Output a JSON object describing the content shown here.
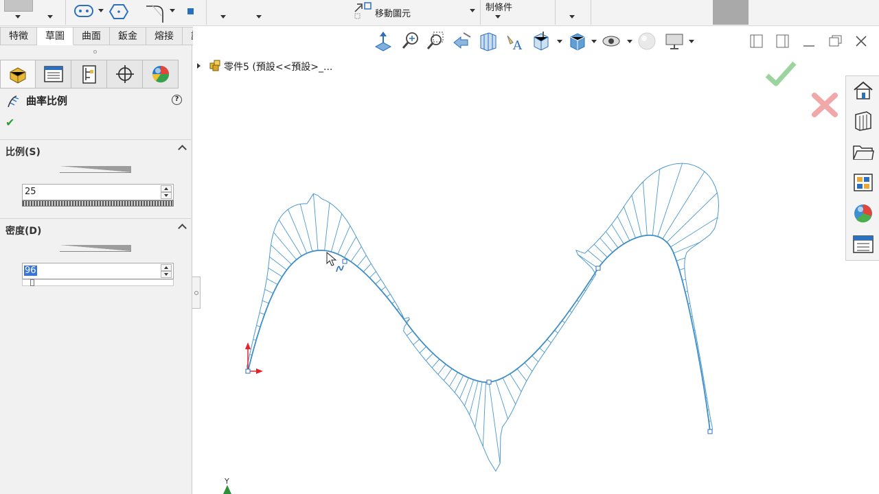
{
  "ribbon": {
    "move_entities_label": "移動圖元",
    "fix_relations_label": "制條件"
  },
  "tabs": [
    {
      "label": "特徵"
    },
    {
      "label": "草圖"
    },
    {
      "label": "曲面"
    },
    {
      "label": "鈑金"
    },
    {
      "label": "熔接"
    },
    {
      "label": "評估"
    }
  ],
  "property_manager": {
    "title": "曲率比例",
    "help_glyph": "?",
    "ok_glyph": "✔",
    "scale_group": {
      "title": "比例(S)",
      "value": "25"
    },
    "density_group": {
      "title": "密度(D)",
      "value": "96"
    }
  },
  "tree": {
    "crumb": "零件5  (預設<<預設>_..."
  },
  "sketch_labels": {
    "y_axis": "Y"
  },
  "colors": {
    "curve": "#3d8dc8",
    "comb": "#4a98cf",
    "accent_blue": "#2b6fbf",
    "ok_green": "#78c27a",
    "cancel_red": "#e06060",
    "origin_red": "#e8202a"
  }
}
